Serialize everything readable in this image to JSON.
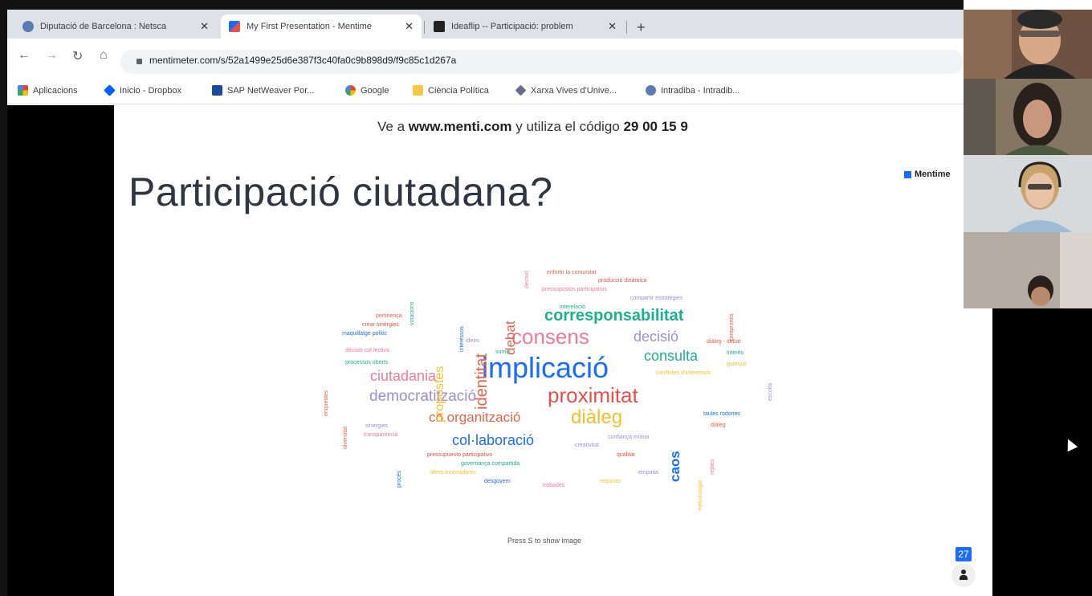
{
  "browser": {
    "tabs": [
      {
        "title": "Diputació de Barcelona : Netsca",
        "active": false,
        "icon": "gov-icon"
      },
      {
        "title": "My First Presentation - Mentime",
        "active": true,
        "icon": "mentimeter-icon"
      },
      {
        "title": "Ideaflip -- Participació: problem",
        "active": false,
        "icon": "ideaflip-icon"
      }
    ],
    "close_glyph": "✕",
    "new_tab_glyph": "+",
    "url": "mentimeter.com/s/52a1499e25d6e387f3c40fa0c9b898d9/f9c85c1d267a",
    "bookmarks": [
      {
        "label": "Aplicacions",
        "icon": "apps-grid-icon"
      },
      {
        "label": "Inicio - Dropbox",
        "icon": "dropbox-icon"
      },
      {
        "label": "SAP NetWeaver Por...",
        "icon": "sap-icon"
      },
      {
        "label": "Google",
        "icon": "google-icon"
      },
      {
        "label": "Ciència Política",
        "icon": "folder-icon"
      },
      {
        "label": "Xarxa Vives d'Unive...",
        "icon": "xarxa-icon"
      },
      {
        "label": "Intradiba - Intradib...",
        "icon": "gov-icon"
      }
    ]
  },
  "slide": {
    "instructions_pre": "Ve a ",
    "instructions_site": "www.menti.com",
    "instructions_mid": " y utiliza el código ",
    "instructions_code": "29 00 15 9",
    "brand": "Mentime",
    "title": "Participació ciutadana?",
    "press_hint": "Press S to show image",
    "participants_count": "27"
  },
  "wordcloud": {
    "words": [
      {
        "text": "implicació",
        "color": "#196cff"
      },
      {
        "text": "consens",
        "color": "#f07a9c"
      },
      {
        "text": "proximitat",
        "color": "#e8514a"
      },
      {
        "text": "corresponsabilitat",
        "color": "#19b38a"
      },
      {
        "text": "diàleg",
        "color": "#f3c12b"
      },
      {
        "text": "democratització",
        "color": "#9b8fd9"
      },
      {
        "text": "ciutadania",
        "color": "#f07a9c"
      },
      {
        "text": "decisió",
        "color": "#9b8fd9"
      },
      {
        "text": "consulta",
        "color": "#19b38a"
      },
      {
        "text": "co organització",
        "color": "#e8624a"
      },
      {
        "text": "col·laboració",
        "color": "#196cff"
      },
      {
        "text": "identitat",
        "color": "#e8624a"
      },
      {
        "text": "debat",
        "color": "#e8624a"
      },
      {
        "text": "propostes",
        "color": "#f3c12b"
      },
      {
        "text": "caos",
        "color": "#196cff"
      },
      {
        "text": "votacions",
        "color": "#19b38a"
      },
      {
        "text": "interessos",
        "color": "#196cff"
      },
      {
        "text": "idees",
        "color": "#9b8fd9"
      },
      {
        "text": "sumar",
        "color": "#19b38a"
      },
      {
        "text": "enfortir la comunitat",
        "color": "#e8624a"
      },
      {
        "text": "producció dinàmica",
        "color": "#e8514a"
      },
      {
        "text": "pressupostos participatius",
        "color": "#f07a9c"
      },
      {
        "text": "compartir estratègies",
        "color": "#9b8fd9"
      },
      {
        "text": "interelació",
        "color": "#19b38a"
      },
      {
        "text": "pertinença",
        "color": "#e8624a"
      },
      {
        "text": "crear sinèrgies",
        "color": "#e8514a"
      },
      {
        "text": "maquillatge polític",
        "color": "#196cff"
      },
      {
        "text": "decisió col·lectiva",
        "color": "#f07a9c"
      },
      {
        "text": "processos oberts",
        "color": "#19b38a"
      },
      {
        "text": "diàleg - debat",
        "color": "#e8624a"
      },
      {
        "text": "interès",
        "color": "#19b38a"
      },
      {
        "text": "guanyar",
        "color": "#f3c12b"
      },
      {
        "text": "conflictes d'interessos",
        "color": "#f3c12b"
      },
      {
        "text": "taules rodones",
        "color": "#196cff"
      },
      {
        "text": "diàleg",
        "color": "#e8624a"
      },
      {
        "text": "confiança mútua",
        "color": "#9b8fd9"
      },
      {
        "text": "creativitat",
        "color": "#9b8fd9"
      },
      {
        "text": "qualitat",
        "color": "#e8514a"
      },
      {
        "text": "sinergies",
        "color": "#9b8fd9"
      },
      {
        "text": "transparència",
        "color": "#f07a9c"
      },
      {
        "text": "pressupuesto participativo",
        "color": "#e8514a"
      },
      {
        "text": "governança compartida",
        "color": "#19b38a"
      },
      {
        "text": "idees innovadores",
        "color": "#f3c12b"
      },
      {
        "text": "desgovern",
        "color": "#196cff"
      },
      {
        "text": "trobades",
        "color": "#f07a9c"
      },
      {
        "text": "requisits",
        "color": "#f3c12b"
      },
      {
        "text": "empatia",
        "color": "#9b8fd9"
      },
      {
        "text": "enquestes",
        "color": "#e8624a"
      },
      {
        "text": "diversitat",
        "color": "#e8624a"
      },
      {
        "text": "procés",
        "color": "#196cff"
      },
      {
        "text": "metodologia",
        "color": "#f3c12b"
      },
      {
        "text": "reptes",
        "color": "#f07a9c"
      },
      {
        "text": "compromís",
        "color": "#e8514a"
      },
      {
        "text": "escolta",
        "color": "#9b8fd9"
      },
      {
        "text": "decisió",
        "color": "#f07a9c"
      }
    ]
  },
  "participants": [
    {
      "label": "participant-1",
      "bg": "#7a5a47"
    },
    {
      "label": "participant-2",
      "bg": "#7f7263"
    },
    {
      "label": "participant-3",
      "bg": "#b8bcc0"
    },
    {
      "label": "participant-4",
      "bg": "#a9a29a"
    }
  ]
}
